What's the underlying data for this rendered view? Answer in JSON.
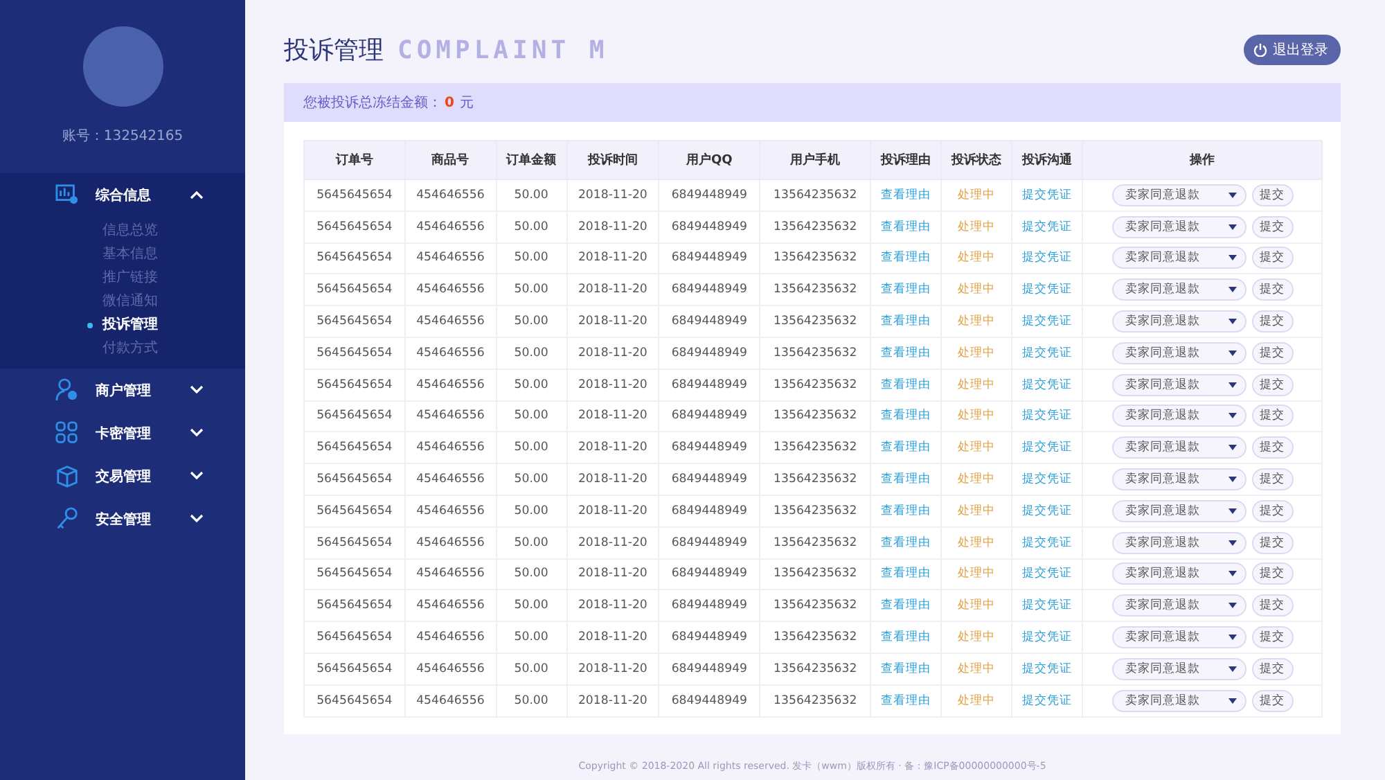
{
  "sidebar": {
    "account": "账号：132542165",
    "menu": [
      {
        "label": "综合信息",
        "expanded": true,
        "children": [
          {
            "label": "信息总览",
            "selected": false
          },
          {
            "label": "基本信息",
            "selected": false
          },
          {
            "label": "推广链接",
            "selected": false
          },
          {
            "label": "微信通知",
            "selected": false
          },
          {
            "label": "投诉管理",
            "selected": true
          },
          {
            "label": "付款方式",
            "selected": false
          }
        ]
      },
      {
        "label": "商户管理",
        "expanded": false
      },
      {
        "label": "卡密管理",
        "expanded": false
      },
      {
        "label": "交易管理",
        "expanded": false
      },
      {
        "label": "安全管理",
        "expanded": false
      }
    ]
  },
  "header": {
    "title": "投诉管理",
    "subtitle": "COMPLAINT M",
    "logout": "退出登录"
  },
  "notice": {
    "label": "您被投诉总冻结金额：",
    "amount": "0",
    "unit": "元"
  },
  "table": {
    "columns": [
      "订单号",
      "商品号",
      "订单金额",
      "投诉时间",
      "用户QQ",
      "用户手机",
      "投诉理由",
      "投诉状态",
      "投诉沟通",
      "操作"
    ],
    "rows": [
      {
        "order": "5645645654",
        "product": "454646556",
        "amount": "50.00",
        "time": "2018-11-20",
        "qq": "6849448949",
        "phone": "13564235632",
        "reason": "查看理由",
        "status": "处理中",
        "evidence": "提交凭证",
        "action": "卖家同意退款",
        "submit": "提交"
      },
      {
        "order": "5645645654",
        "product": "454646556",
        "amount": "50.00",
        "time": "2018-11-20",
        "qq": "6849448949",
        "phone": "13564235632",
        "reason": "查看理由",
        "status": "处理中",
        "evidence": "提交凭证",
        "action": "卖家同意退款",
        "submit": "提交"
      },
      {
        "order": "5645645654",
        "product": "454646556",
        "amount": "50.00",
        "time": "2018-11-20",
        "qq": "6849448949",
        "phone": "13564235632",
        "reason": "查看理由",
        "status": "处理中",
        "evidence": "提交凭证",
        "action": "卖家同意退款",
        "submit": "提交"
      },
      {
        "order": "5645645654",
        "product": "454646556",
        "amount": "50.00",
        "time": "2018-11-20",
        "qq": "6849448949",
        "phone": "13564235632",
        "reason": "查看理由",
        "status": "处理中",
        "evidence": "提交凭证",
        "action": "卖家同意退款",
        "submit": "提交"
      },
      {
        "order": "5645645654",
        "product": "454646556",
        "amount": "50.00",
        "time": "2018-11-20",
        "qq": "6849448949",
        "phone": "13564235632",
        "reason": "查看理由",
        "status": "处理中",
        "evidence": "提交凭证",
        "action": "卖家同意退款",
        "submit": "提交"
      },
      {
        "order": "5645645654",
        "product": "454646556",
        "amount": "50.00",
        "time": "2018-11-20",
        "qq": "6849448949",
        "phone": "13564235632",
        "reason": "查看理由",
        "status": "处理中",
        "evidence": "提交凭证",
        "action": "卖家同意退款",
        "submit": "提交"
      },
      {
        "order": "5645645654",
        "product": "454646556",
        "amount": "50.00",
        "time": "2018-11-20",
        "qq": "6849448949",
        "phone": "13564235632",
        "reason": "查看理由",
        "status": "处理中",
        "evidence": "提交凭证",
        "action": "卖家同意退款",
        "submit": "提交"
      },
      {
        "order": "5645645654",
        "product": "454646556",
        "amount": "50.00",
        "time": "2018-11-20",
        "qq": "6849448949",
        "phone": "13564235632",
        "reason": "查看理由",
        "status": "处理中",
        "evidence": "提交凭证",
        "action": "卖家同意退款",
        "submit": "提交"
      },
      {
        "order": "5645645654",
        "product": "454646556",
        "amount": "50.00",
        "time": "2018-11-20",
        "qq": "6849448949",
        "phone": "13564235632",
        "reason": "查看理由",
        "status": "处理中",
        "evidence": "提交凭证",
        "action": "卖家同意退款",
        "submit": "提交"
      },
      {
        "order": "5645645654",
        "product": "454646556",
        "amount": "50.00",
        "time": "2018-11-20",
        "qq": "6849448949",
        "phone": "13564235632",
        "reason": "查看理由",
        "status": "处理中",
        "evidence": "提交凭证",
        "action": "卖家同意退款",
        "submit": "提交"
      },
      {
        "order": "5645645654",
        "product": "454646556",
        "amount": "50.00",
        "time": "2018-11-20",
        "qq": "6849448949",
        "phone": "13564235632",
        "reason": "查看理由",
        "status": "处理中",
        "evidence": "提交凭证",
        "action": "卖家同意退款",
        "submit": "提交"
      },
      {
        "order": "5645645654",
        "product": "454646556",
        "amount": "50.00",
        "time": "2018-11-20",
        "qq": "6849448949",
        "phone": "13564235632",
        "reason": "查看理由",
        "status": "处理中",
        "evidence": "提交凭证",
        "action": "卖家同意退款",
        "submit": "提交"
      },
      {
        "order": "5645645654",
        "product": "454646556",
        "amount": "50.00",
        "time": "2018-11-20",
        "qq": "6849448949",
        "phone": "13564235632",
        "reason": "查看理由",
        "status": "处理中",
        "evidence": "提交凭证",
        "action": "卖家同意退款",
        "submit": "提交"
      },
      {
        "order": "5645645654",
        "product": "454646556",
        "amount": "50.00",
        "time": "2018-11-20",
        "qq": "6849448949",
        "phone": "13564235632",
        "reason": "查看理由",
        "status": "处理中",
        "evidence": "提交凭证",
        "action": "卖家同意退款",
        "submit": "提交"
      },
      {
        "order": "5645645654",
        "product": "454646556",
        "amount": "50.00",
        "time": "2018-11-20",
        "qq": "6849448949",
        "phone": "13564235632",
        "reason": "查看理由",
        "status": "处理中",
        "evidence": "提交凭证",
        "action": "卖家同意退款",
        "submit": "提交"
      },
      {
        "order": "5645645654",
        "product": "454646556",
        "amount": "50.00",
        "time": "2018-11-20",
        "qq": "6849448949",
        "phone": "13564235632",
        "reason": "查看理由",
        "status": "处理中",
        "evidence": "提交凭证",
        "action": "卖家同意退款",
        "submit": "提交"
      },
      {
        "order": "5645645654",
        "product": "454646556",
        "amount": "50.00",
        "time": "2018-11-20",
        "qq": "6849448949",
        "phone": "13564235632",
        "reason": "查看理由",
        "status": "处理中",
        "evidence": "提交凭证",
        "action": "卖家同意退款",
        "submit": "提交"
      }
    ]
  },
  "footer": "Copyright © 2018-2020 All rights reserved. 发卡（wwm）版权所有 · 备：豫ICP备00000000000号-5"
}
